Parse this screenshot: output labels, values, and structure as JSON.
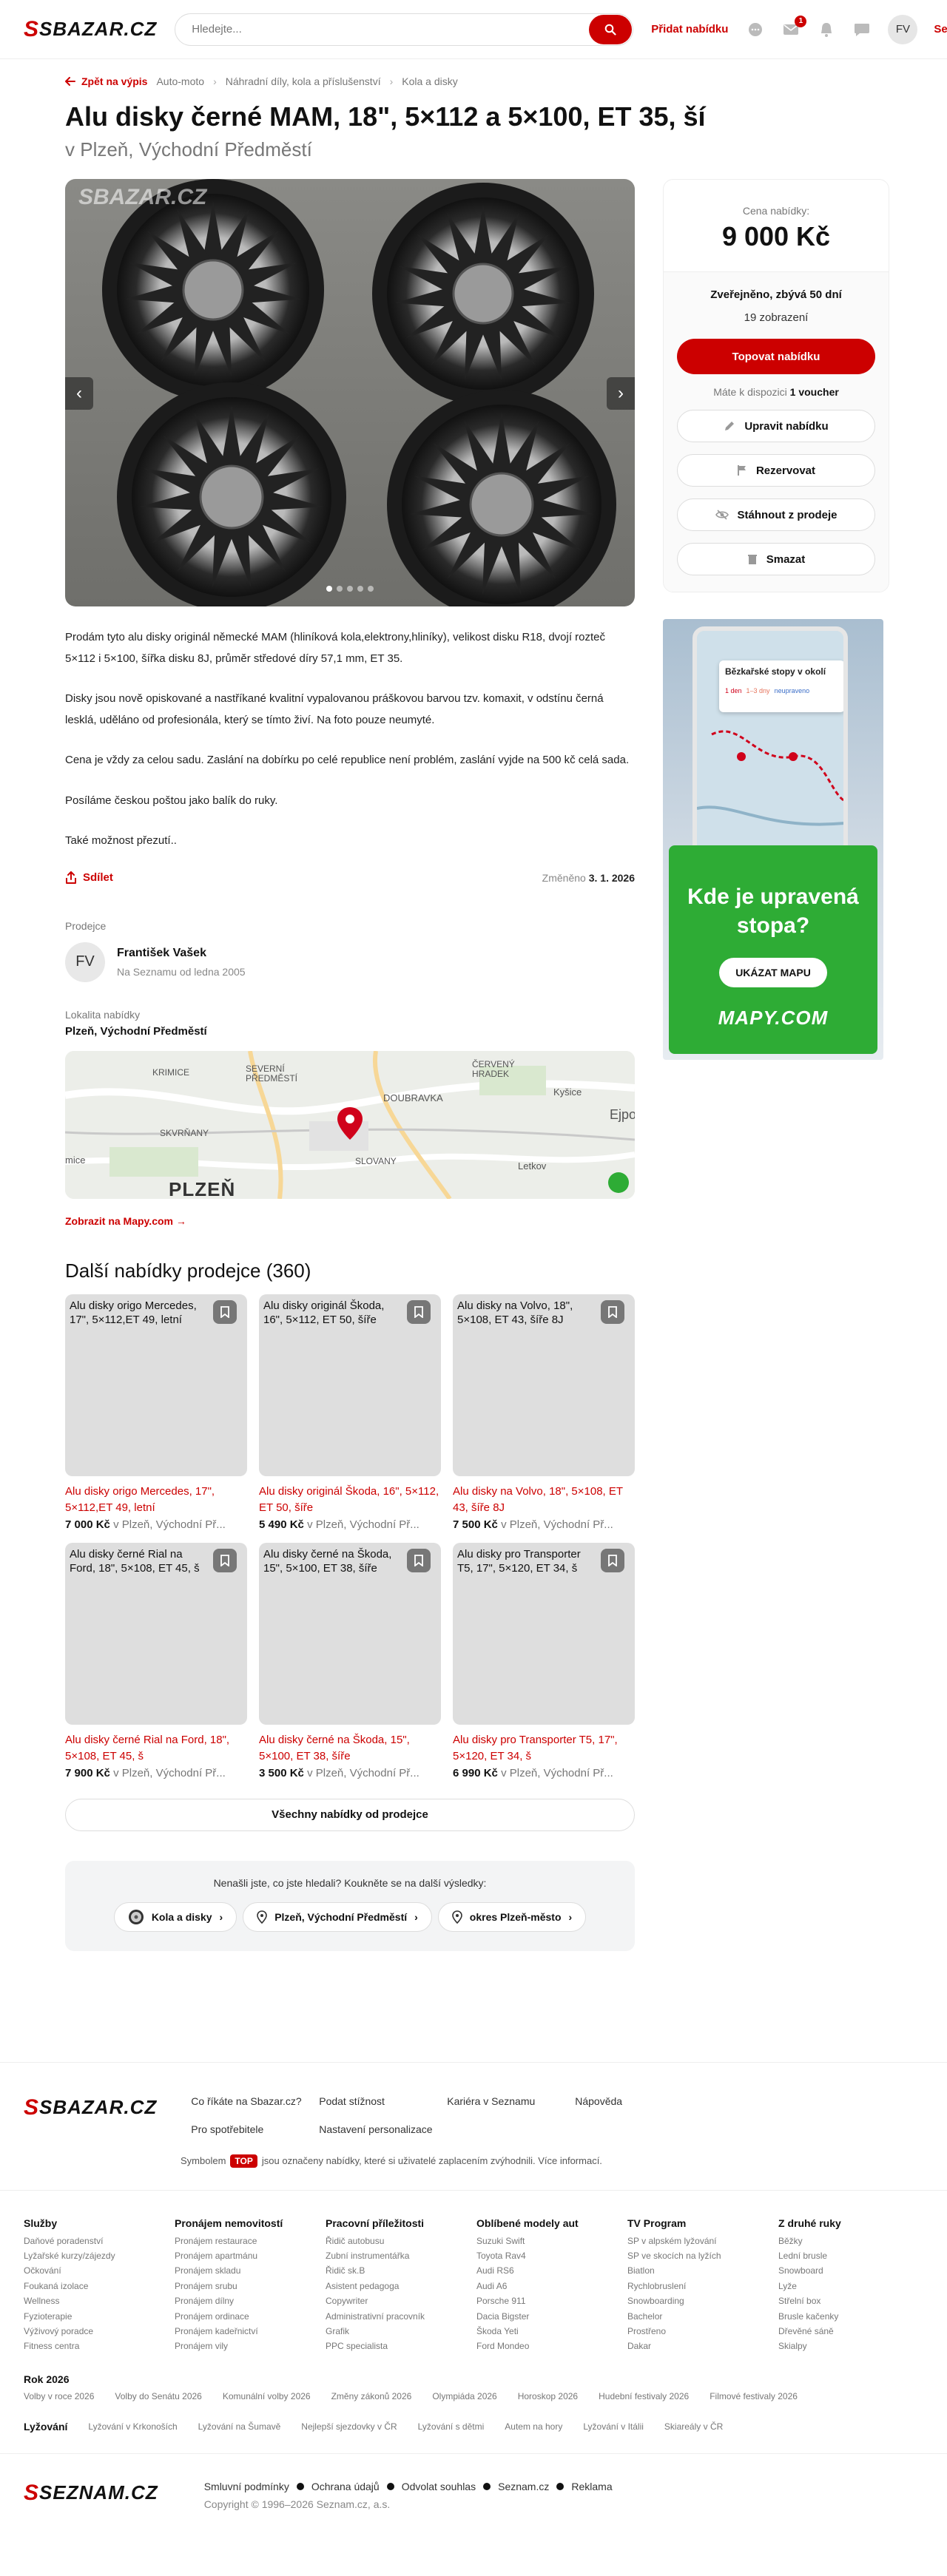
{
  "header": {
    "logo": "SBAZAR.CZ",
    "search_placeholder": "Hledejte...",
    "add_label": "Přidat nabídku",
    "mail_badge": "1",
    "avatar": "FV",
    "seznam_label": "Seznam.cz"
  },
  "breadcrumb": {
    "back": "Zpět na výpis",
    "items": [
      "Auto-moto",
      "Náhradní díly, kola a příslušenství",
      "Kola a disky"
    ]
  },
  "listing": {
    "title": "Alu disky černé MAM, 18\", 5×112 a 5×100, ET 35, ší",
    "location_heading": "v Plzeň, Východní Předměstí",
    "gallery_watermark": "SBAZAR.CZ",
    "description": [
      "Prodám tyto alu disky originál německé MAM (hliníková kola,elektrony,hliníky), velikost disku R18, dvojí rozteč 5×112 i 5×100, šířka disku 8J, průměr středové díry 57,1 mm, ET 35.",
      "Disky jsou nově opiskované a nastříkané kvalitní vypalovanou práškovou barvou tzv. komaxit, v odstínu černá lesklá, uděláno od profesionála, který se tímto živí. Na foto pouze neumyté.",
      "Cena je vždy za celou sadu. Zaslání na dobírku po celé republice není problém, zaslání vyjde na 500 kč celá sada.",
      "Posíláme českou poštou jako balík do ruky.",
      "Také možnost přezutí.."
    ],
    "share_label": "Sdílet",
    "changed_label": "Změněno",
    "changed_date": "3. 1. 2026",
    "seller_label": "Prodejce",
    "seller_initials": "FV",
    "seller_name": "František Vašek",
    "seller_since": "Na Seznamu od ledna 2005",
    "locality_label": "Lokalita nabídky",
    "locality": "Plzeň, Východní Předměstí",
    "map_labels": [
      "KRIMICE",
      "SEVERNÍ PŘEDMĚSTÍ",
      "ČERVENÝ HRADEK",
      "DOUBRAVKA",
      "Kyšice",
      "Ejpovice",
      "SKVRŇANY",
      "SLOVANY",
      "Letkov",
      "PLZEŇ",
      "mice"
    ],
    "map_link": "Zobrazit na Mapy.com →"
  },
  "sidebar": {
    "price_label": "Cena nabídky:",
    "price": "9 000 Kč",
    "published": "Zveřejněno, zbývá 50 dní",
    "views": "19 zobrazení",
    "top_button": "Topovat nabídku",
    "voucher_prefix": "Máte k dispozici",
    "voucher_count": "1 voucher",
    "edit_button": "Upravit nabídku",
    "reserve_button": "Rezervovat",
    "withdraw_button": "Stáhnout z prodeje",
    "delete_button": "Smazat"
  },
  "ad": {
    "card_title": "Bězkařské stopy v okolí",
    "card_legend": [
      "1 den",
      "1–3 dny",
      "neupraveno"
    ],
    "headline_1": "Kde je upravená",
    "headline_2": "stopa?",
    "button": "UKÁZAT MAPU",
    "logo": "MAPY.COM"
  },
  "more": {
    "heading": "Další nabídky prodejce (360)",
    "cards": [
      {
        "thumb": "Alu disky origo Mercedes, 17\", 5×112,ET 49, letní",
        "title": "Alu disky origo Mercedes, 17\", 5×112,ET 49, letní",
        "price": "7 000 Kč",
        "loc": "v Plzeň, Východní Př..."
      },
      {
        "thumb": "Alu disky originál Škoda, 16\", 5×112, ET 50, šíře",
        "title": "Alu disky originál Škoda, 16\", 5×112, ET 50, šíře",
        "price": "5 490 Kč",
        "loc": "v Plzeň, Východní Př..."
      },
      {
        "thumb": "Alu disky na Volvo, 18\", 5×108, ET 43, šíře 8J",
        "title": "Alu disky na Volvo, 18\", 5×108, ET 43, šíře 8J",
        "price": "7 500 Kč",
        "loc": "v Plzeň, Východní Př..."
      },
      {
        "thumb": "Alu disky černé Rial na Ford, 18\", 5×108, ET 45, š",
        "title": "Alu disky černé Rial na Ford, 18\", 5×108, ET 45, š",
        "price": "7 900 Kč",
        "loc": "v Plzeň, Východní Př..."
      },
      {
        "thumb": "Alu disky černé na Škoda, 15\", 5×100, ET 38, šíře",
        "title": "Alu disky černé na Škoda, 15\", 5×100, ET 38, šíře",
        "price": "3 500 Kč",
        "loc": "v Plzeň, Východní Př..."
      },
      {
        "thumb": "Alu disky pro Transporter T5, 17\", 5×120, ET 34, š",
        "title": "Alu disky pro Transporter T5, 17\", 5×120, ET 34, š",
        "price": "6 990 Kč",
        "loc": "v Plzeň, Východní Př..."
      }
    ],
    "all_button": "Všechny nabídky od prodejce"
  },
  "refine": {
    "question": "Nenašli jste, co jste hledali? Koukněte se na další výsledky:",
    "chips": [
      "Kola a disky",
      "Plzeň, Východní Předměstí",
      "okres Plzeň-město"
    ]
  },
  "footer": {
    "logo": "SBAZAR.CZ",
    "links": [
      "Co říkáte na Sbazar.cz?",
      "Podat stížnost",
      "Kariéra v Seznamu",
      "Nápověda",
      "Pro spotřebitele",
      "Nastavení personalizace"
    ],
    "note_prefix": "Symbolem",
    "note_badge": "TOP",
    "note_suffix": "jsou označeny nabídky, které si uživatelé zaplacením zvýhodnili. Více informací.",
    "columns": [
      {
        "title": "Služby",
        "items": [
          "Daňové poradenství",
          "Lyžařské kurzy/zájezdy",
          "Očkování",
          "Foukaná izolace",
          "Wellness",
          "Fyzioterapie",
          "Výživový poradce",
          "Fitness centra"
        ]
      },
      {
        "title": "Pronájem nemovitostí",
        "items": [
          "Pronájem restaurace",
          "Pronájem apartmánu",
          "Pronájem skladu",
          "Pronájem srubu",
          "Pronájem dílny",
          "Pronájem ordinace",
          "Pronájem kadeřnictví",
          "Pronájem vily"
        ]
      },
      {
        "title": "Pracovní příležitosti",
        "items": [
          "Řidič autobusu",
          "Zubní instrumentářka",
          "Řidič sk.B",
          "Asistent pedagoga",
          "Copywriter",
          "Administrativní pracovník",
          "Grafik",
          "PPC specialista"
        ]
      },
      {
        "title": "Oblíbené modely aut",
        "items": [
          "Suzuki Swift",
          "Toyota Rav4",
          "Audi RS6",
          "Audi A6",
          "Porsche 911",
          "Dacia Bigster",
          "Škoda Yeti",
          "Ford Mondeo"
        ]
      },
      {
        "title": "TV Program",
        "items": [
          "SP v alpském lyžování",
          "SP ve skocích na lyžích",
          "Biatlon",
          "Rychlobruslení",
          "Snowboarding",
          "Bachelor",
          "Prostřeno",
          "Dakar"
        ]
      },
      {
        "title": "Z druhé ruky",
        "items": [
          "Běžky",
          "Lední brusle",
          "Snowboard",
          "Lyže",
          "Střelní box",
          "Brusle kačenky",
          "Dřevěné sáně",
          "Skialpy"
        ]
      }
    ],
    "year_title": "Rok 2026",
    "year_items": [
      "Volby v roce 2026",
      "Volby do Senátu 2026",
      "Komunální volby 2026",
      "Změny zákonů 2026",
      "Olympiáda 2026",
      "Horoskop 2026",
      "Hudební festivaly 2026",
      "Filmové festivaly 2026"
    ],
    "ski_title": "Lyžování",
    "ski_items": [
      "Lyžování v Krkonoších",
      "Lyžování na Šumavě",
      "Nejlepší sjezdovky v ČR",
      "Lyžování s dětmi",
      "Autem na hory",
      "Lyžování v Itálii",
      "Skiareály v ČR"
    ],
    "seznam_logo": "SEZNAM.CZ",
    "legal": [
      "Smluvní podmínky",
      "Ochrana údajů",
      "Odvolat souhlas",
      "Seznam.cz",
      "Reklama"
    ],
    "copyright": "Copyright © 1996–2026 Seznam.cz, a.s."
  }
}
